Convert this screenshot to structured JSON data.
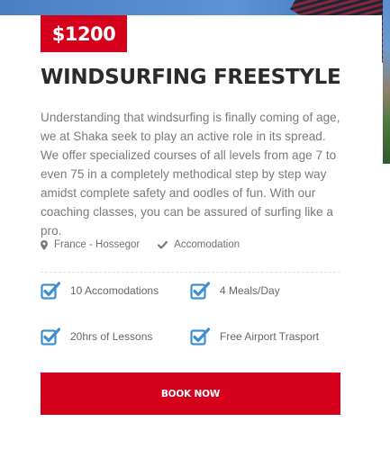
{
  "tour": {
    "price": "$1200",
    "title": "WINDSURFING FREESTYLE",
    "description": "Understanding that windsurfing is finally coming of age, we at Shaka seek to play an active role in its spread. We offer specialized courses of all levels from age 7 to even 75 in a completely methodical step by step way amidst complete safety and oodles of fun. With our coaching classes, you can be assured of surfing like a pro."
  },
  "meta": {
    "location": {
      "icon": "map-pin-icon",
      "label": "France - Hossegor"
    },
    "accommodation": {
      "icon": "check-icon",
      "label": "Accomodation"
    }
  },
  "features": [
    {
      "icon": "checkbox-checked-icon",
      "label": "10 Accomodations"
    },
    {
      "icon": "checkbox-checked-icon",
      "label": "4 Meals/Day"
    },
    {
      "icon": "checkbox-checked-icon",
      "label": "20hrs of Lessons"
    },
    {
      "icon": "checkbox-checked-icon",
      "label": "Free Airport Trasport"
    }
  ],
  "actions": {
    "book_label": "BOOK NOW"
  },
  "colors": {
    "accent": "#d5001c",
    "icon_blue": "#3d8fd1",
    "title": "#2b2b2b",
    "body_text": "#7a7a7a"
  }
}
